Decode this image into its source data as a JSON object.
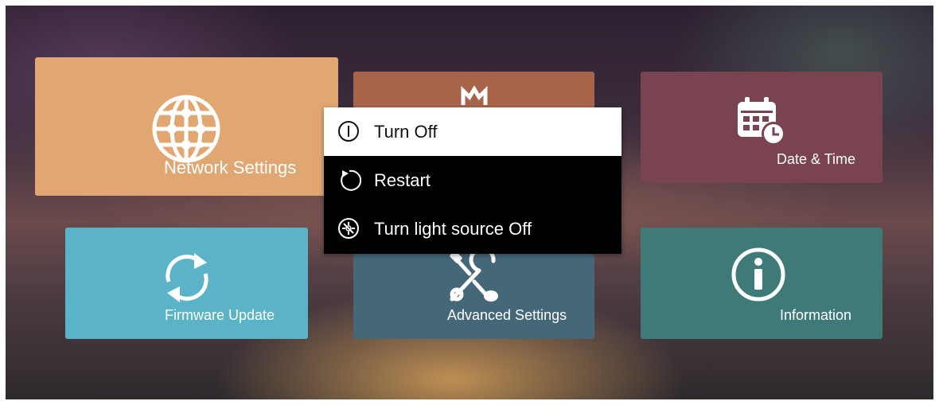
{
  "tiles": {
    "network": {
      "label": "Network Settings",
      "icon": "globe-network-icon"
    },
    "middle": {
      "label": "",
      "icon": "partial-hidden-icon"
    },
    "date": {
      "label": "Date & Time",
      "icon": "calendar-clock-icon"
    },
    "firmware": {
      "label": "Firmware Update",
      "icon": "refresh-arrows-icon"
    },
    "advanced": {
      "label": "Advanced Settings",
      "icon": "tools-icon"
    },
    "information": {
      "label": "Information",
      "icon": "info-icon"
    }
  },
  "power_menu": {
    "items": [
      {
        "label": "Turn Off",
        "icon": "power-icon",
        "selected": true
      },
      {
        "label": "Restart",
        "icon": "restart-icon",
        "selected": false
      },
      {
        "label": "Turn light source Off",
        "icon": "light-off-icon",
        "selected": false
      }
    ]
  },
  "colors": {
    "network": "#e0a772",
    "middle": "#a8644b",
    "date": "#7a4350",
    "firmware": "#5ab3c6",
    "advanced": "#456879",
    "information": "#3e7a78",
    "menu_bg": "#000000",
    "menu_selected_bg": "#ffffff"
  }
}
